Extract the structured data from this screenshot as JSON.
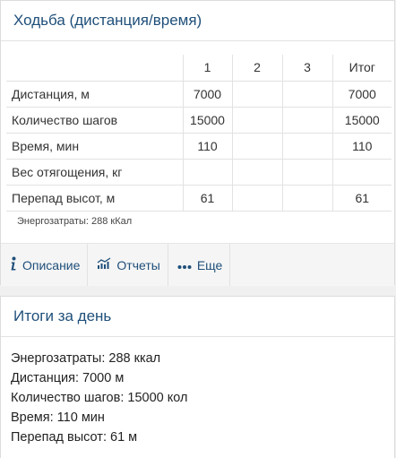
{
  "walking_card": {
    "title": "Ходьба (дистанция/время)",
    "columns": [
      "",
      "1",
      "2",
      "3",
      "Итог"
    ],
    "rows": [
      {
        "label": "Дистанция, м",
        "v1": "7000",
        "v2": "",
        "v3": "",
        "total": "7000"
      },
      {
        "label": "Количество шагов",
        "v1": "15000",
        "v2": "",
        "v3": "",
        "total": "15000"
      },
      {
        "label": "Время, мин",
        "v1": "110",
        "v2": "",
        "v3": "",
        "total": "110"
      },
      {
        "label": "Вес отягощения, кг",
        "v1": "",
        "v2": "",
        "v3": "",
        "total": ""
      },
      {
        "label": "Перепад высот, м",
        "v1": "61",
        "v2": "",
        "v3": "",
        "total": "61"
      }
    ],
    "energy_note": "Энергозатраты: 288 кКал",
    "toolbar": {
      "description_label": "Описание",
      "reports_label": "Отчеты",
      "more_label": "Еще",
      "description_icon": "info-icon",
      "reports_icon": "chart-icon",
      "more_icon": "dots-icon"
    }
  },
  "day_summary": {
    "title": "Итоги за день",
    "lines": [
      "Энергозатраты: 288 ккал",
      "Дистанция: 7000 м",
      "Количество шагов: 15000 кол",
      "Время: 110 мин",
      "Перепад высот: 61 м"
    ]
  },
  "colors": {
    "accent": "#1f4f7a",
    "toolbar_bg": "#f5f5f5",
    "page_bg": "#f0f0f0"
  }
}
